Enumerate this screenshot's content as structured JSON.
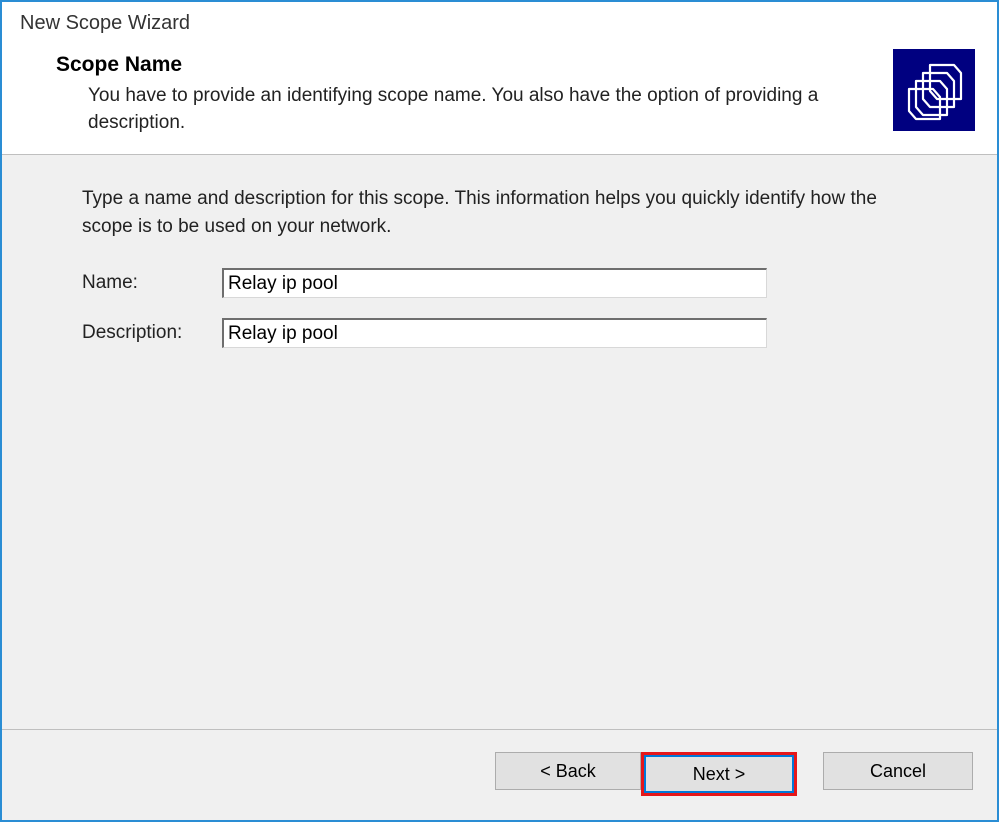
{
  "window": {
    "title": "New Scope Wizard"
  },
  "header": {
    "title": "Scope Name",
    "subtitle": "You have to provide an identifying scope name. You also have the option of providing a description.",
    "icon_name": "folders-icon"
  },
  "body": {
    "description": "Type a name and description for this scope. This information helps you quickly identify how the scope is to be used on your network.",
    "name_label": "Name:",
    "name_value": "Relay ip pool",
    "description_label": "Description:",
    "description_value": "Relay ip pool"
  },
  "footer": {
    "back_label": "< Back",
    "next_label": "Next >",
    "cancel_label": "Cancel"
  }
}
